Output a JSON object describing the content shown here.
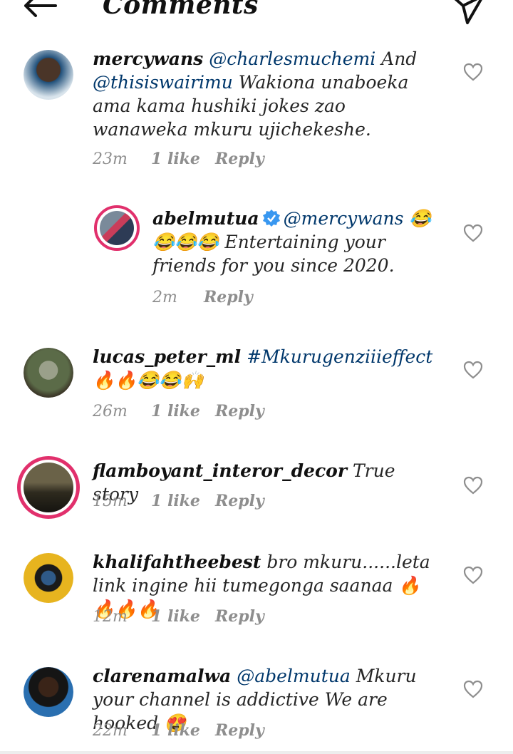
{
  "header": {
    "title": "Comments",
    "back_icon": "arrow-left-icon",
    "send_icon": "paper-plane-icon"
  },
  "comments": [
    {
      "username": "mercywans",
      "parts": [
        {
          "type": "mention",
          "text": "@charlesmuchemi"
        },
        {
          "type": "text",
          "text": " And "
        },
        {
          "type": "mention",
          "text": "@thisiswairimu"
        },
        {
          "type": "text",
          "text": " Wakiona unaboeka ama kama hushiki jokes zao wanaweka mkuru ujichekeshe."
        }
      ],
      "time": "23m",
      "likes": "1 like",
      "reply": "Reply"
    },
    {
      "username": "abelmutua",
      "verified": true,
      "parts": [
        {
          "type": "mention",
          "text": "@mercywans"
        },
        {
          "type": "text",
          "text": " 😂😂😂😂 Entertaining your friends for you since 2020."
        }
      ],
      "time": "2m",
      "likes": "",
      "reply": "Reply"
    },
    {
      "username": "lucas_peter_ml",
      "parts": [
        {
          "type": "tag",
          "text": "#Mkurugenziiieffect"
        },
        {
          "type": "text",
          "text": " 🔥🔥😂😂🙌"
        }
      ],
      "time": "26m",
      "likes": "1 like",
      "reply": "Reply"
    },
    {
      "username": "flamboyant_interor_decor",
      "parts": [
        {
          "type": "text",
          "text": "True story"
        }
      ],
      "time": "15m",
      "likes": "1 like",
      "reply": "Reply"
    },
    {
      "username": "khalifahtheebest",
      "parts": [
        {
          "type": "text",
          "text": "bro mkuru......leta link ingine hii tumegonga saanaa 🔥🔥🔥🔥"
        }
      ],
      "time": "12m",
      "likes": "1 like",
      "reply": "Reply"
    },
    {
      "username": "clarenamalwa",
      "parts": [
        {
          "type": "mention",
          "text": "@abelmutua"
        },
        {
          "type": "text",
          "text": " Mkuru your channel is addictive We are hooked 😍"
        }
      ],
      "time": "22m",
      "likes": "1 like",
      "reply": "Reply"
    }
  ],
  "colors": {
    "mention": "#00376b",
    "meta": "#8e8e8e",
    "story_ring": "#e1306c",
    "verified": "#3897f0"
  }
}
